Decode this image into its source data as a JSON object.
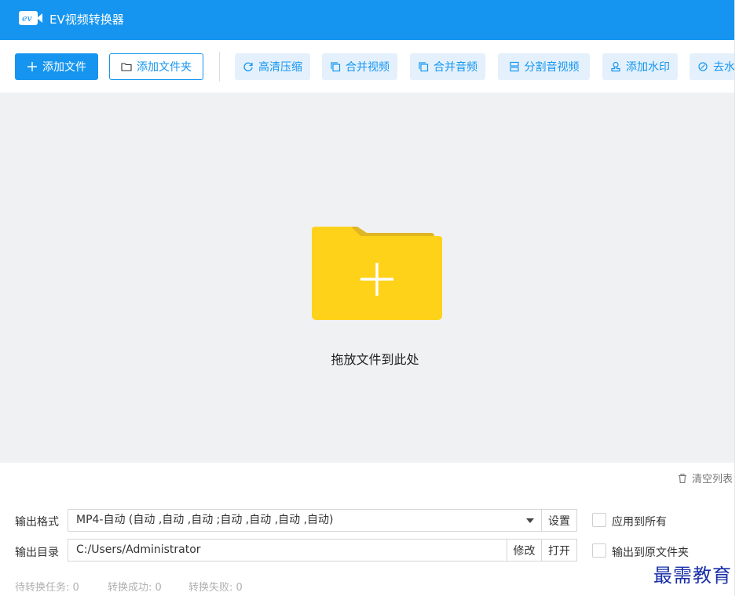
{
  "app": {
    "title": "EV视频转换器",
    "logo_text": "ev",
    "accent_color": "#1595f0"
  },
  "toolbar": {
    "add_file": "添加文件",
    "add_folder": "添加文件夹",
    "tools": [
      {
        "label": "高清压缩",
        "icon": "refresh-icon"
      },
      {
        "label": "合并视频",
        "icon": "copy-icon"
      },
      {
        "label": "合并音频",
        "icon": "copy-icon"
      },
      {
        "label": "分割音视频",
        "icon": "split-icon"
      },
      {
        "label": "添加水印",
        "icon": "stamp-icon"
      },
      {
        "label": "去水",
        "icon": "drop-icon"
      }
    ]
  },
  "dropzone": {
    "text": "拖放文件到此处",
    "icon": "folder-plus-icon",
    "folder_color": "#ffd21a"
  },
  "list": {
    "clear_label": "清空列表"
  },
  "output": {
    "format_label": "输出格式",
    "format_value": "MP4-自动 (自动 ,自动 ,自动 ;自动 ,自动 ,自动 ,自动)",
    "settings_label": "设置",
    "apply_all_label": "应用到所有",
    "dir_label": "输出目录",
    "dir_value": "C:/Users/Administrator",
    "modify_label": "修改",
    "open_label": "打开",
    "to_source_label": "输出到原文件夹"
  },
  "status": {
    "pending": "待转换任务: 0",
    "success": "转换成功: 0",
    "failed": "转换失败: 0"
  },
  "watermark": {
    "text": "最需教育"
  }
}
